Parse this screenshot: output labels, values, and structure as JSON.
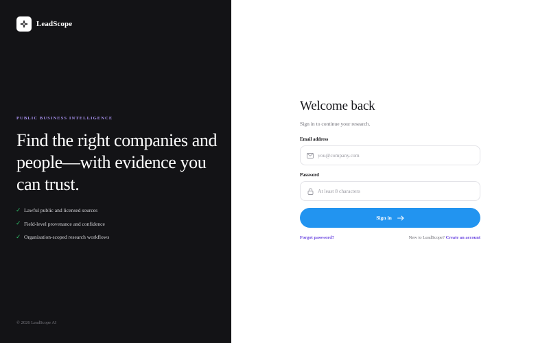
{
  "brand": {
    "name": "LeadScope",
    "icon": "sparkle-icon"
  },
  "hero": {
    "eyebrow": "PUBLIC BUSINESS INTELLIGENCE",
    "headline": "Find the right companies and people—with evidence you can trust.",
    "features": [
      "Lawful public and licensed sources",
      "Field-level provenance and confidence",
      "Organisation-scoped research workflows"
    ],
    "copyright": "© 2026 LeadScope AI"
  },
  "form": {
    "title": "Welcome back",
    "subtitle": "Sign in to continue your research.",
    "email_label": "Email address",
    "email_placeholder": "you@company.com",
    "email_value": "",
    "password_label": "Password",
    "password_placeholder": "At least 8 characters",
    "password_value": "",
    "submit_label": "Sign in",
    "forgot_label": "Forgot password?",
    "new_text": "New to LeadScope?",
    "create_label": "Create an account"
  },
  "colors": {
    "panel_dark": "#131316",
    "accent_purple": "#a992f2",
    "link_purple": "#6b46e0",
    "button_blue": "#2294f0",
    "check_green": "#2fbf6a"
  }
}
